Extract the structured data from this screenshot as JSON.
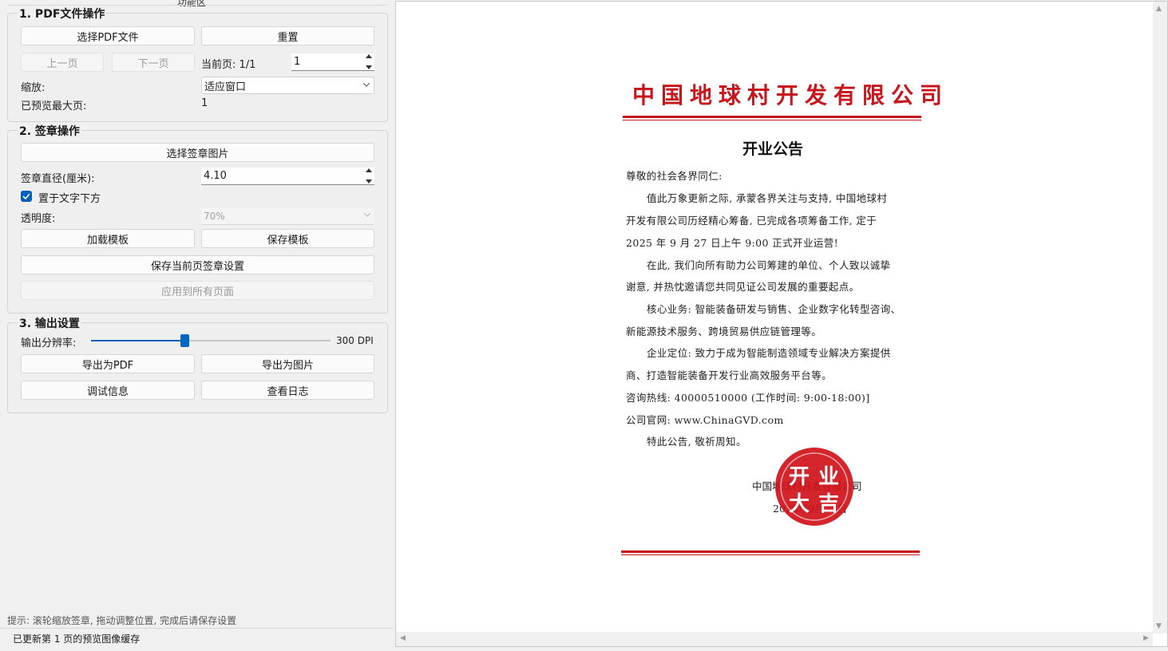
{
  "left_panel": {
    "title": "功能区",
    "section1": {
      "title": "1. PDF文件操作",
      "select_pdf": "选择PDF文件",
      "reset": "重置",
      "prev_page": "上一页",
      "next_page": "下一页",
      "current_page_label": "当前页: 1/1",
      "page_input": "1",
      "zoom_label": "缩放:",
      "zoom_value": "适应窗口",
      "max_page_label": "已预览最大页:",
      "max_page_value": "1"
    },
    "section2": {
      "title": "2. 签章操作",
      "select_seal": "选择签章图片",
      "diameter_label": "签章直径(厘米):",
      "diameter_value": "4.10",
      "below_text_label": "置于文字下方",
      "below_text_checked": true,
      "opacity_label": "透明度:",
      "opacity_value": "70%",
      "load_template": "加载模板",
      "save_template": "保存模板",
      "save_current": "保存当前页签章设置",
      "apply_all": "应用到所有页面"
    },
    "section3": {
      "title": "3. 输出设置",
      "resolution_label": "输出分辨率:",
      "resolution_value": "300 DPI",
      "resolution_fraction": 0.39,
      "export_pdf": "导出为PDF",
      "export_image": "导出为图片",
      "debug_info": "调试信息",
      "view_log": "查看日志"
    },
    "hint": "提示: 滚轮缩放签章, 拖动调整位置, 完成后请保存设置",
    "status": "已更新第 1 页的预览图像缓存"
  },
  "document": {
    "company": "中国地球村开发有限公司",
    "title": "开业公告",
    "greeting": "尊敬的社会各界同仁:",
    "lines": [
      "值此万象更新之际, 承蒙各界关注与支持, 中国地球村",
      "开发有限公司历经精心筹备, 已完成各项筹备工作, 定于",
      "2025 年 9 月 27 日上午 9:00 正式开业运营!",
      "在此, 我们向所有助力公司筹建的单位、个人致以诚挚",
      "谢意, 并热忱邀请您共同见证公司发展的重要起点。",
      "核心业务: 智能装备研发与销售、企业数字化转型咨询、",
      "新能源技术服务、跨境贸易供应链管理等。",
      "企业定位: 致力于成为智能制造领域专业解决方案提供",
      "商、打造智能装备开发行业高效服务平台等。",
      "咨询热线: 40000510000 (工作时间: 9:00-18:00)]",
      "公司官网: www.ChinaGVD.com",
      "特此公告, 敬祈周知。"
    ],
    "signature_company": "中国地球村开发有限公司",
    "signature_date": "2025年9月27日",
    "seal_text": "开业大吉",
    "accent_color": "#c8161d"
  },
  "colors": {
    "primary": "#005fb8",
    "seal_red": "#d0121b"
  }
}
